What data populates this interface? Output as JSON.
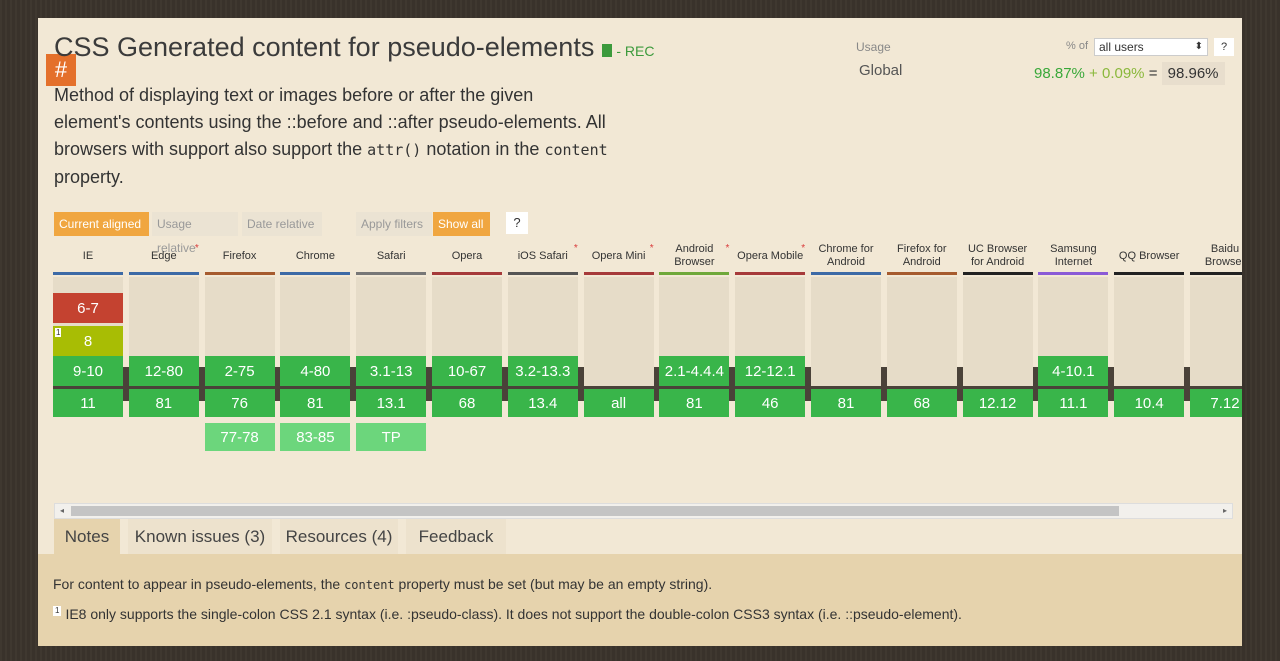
{
  "feature": {
    "hash": "#",
    "title": "CSS Generated content for pseudo-elements",
    "status": "- REC",
    "description_1": "Method of displaying text or images before or after the given element's contents using the ::before and ::after pseudo-elements. All browsers with support also support the ",
    "description_code1": "attr()",
    "description_2": " notation in the ",
    "description_code2": "content",
    "description_3": " property."
  },
  "usage": {
    "label": "Usage",
    "region": "Global",
    "pct_of": "% of",
    "select_value": "all users",
    "help": "?",
    "full": "98.87%",
    "plus": "+",
    "partial": "0.09%",
    "equals": "=",
    "total": "98.96%"
  },
  "filters": {
    "current_aligned": "Current aligned",
    "usage_relative": "Usage relative",
    "date_relative": "Date relative",
    "apply_filters": "Apply filters",
    "show_all": "Show all",
    "help": "?"
  },
  "colors": {
    "supported": "#39b54a",
    "future": "#6cd67c",
    "unsupported": "#c44230",
    "partial": "#a8bd04",
    "empty": "#e6dcc8",
    "accent": "#f0a640"
  },
  "browsers": [
    {
      "name": "IE",
      "star": false,
      "bar": "#3d6aa6",
      "past": [
        {
          "v": "6-7",
          "s": "n"
        },
        {
          "v": "8",
          "s": "a",
          "note": "1"
        },
        {
          "v": "9-10",
          "s": "y"
        }
      ],
      "current": "11",
      "future": []
    },
    {
      "name": "Edge",
      "star": true,
      "bar": "#3d6aa6",
      "past": [
        {
          "v": "",
          "s": "e"
        },
        {
          "v": "",
          "s": "e"
        },
        {
          "v": "12-80",
          "s": "y"
        }
      ],
      "current": "81",
      "future": []
    },
    {
      "name": "Firefox",
      "star": false,
      "bar": "#a65b2e",
      "past": [
        {
          "v": "",
          "s": "e"
        },
        {
          "v": "",
          "s": "e"
        },
        {
          "v": "2-75",
          "s": "y"
        }
      ],
      "current": "76",
      "future": [
        {
          "v": "77-78"
        }
      ]
    },
    {
      "name": "Chrome",
      "star": false,
      "bar": "#3d6aa6",
      "past": [
        {
          "v": "",
          "s": "e"
        },
        {
          "v": "",
          "s": "e"
        },
        {
          "v": "4-80",
          "s": "y"
        }
      ],
      "current": "81",
      "future": [
        {
          "v": "83-85"
        }
      ]
    },
    {
      "name": "Safari",
      "star": false,
      "bar": "#777777",
      "past": [
        {
          "v": "",
          "s": "e"
        },
        {
          "v": "",
          "s": "e"
        },
        {
          "v": "3.1-13",
          "s": "y"
        }
      ],
      "current": "13.1",
      "future": [
        {
          "v": "TP"
        }
      ]
    },
    {
      "name": "Opera",
      "star": false,
      "bar": "#a63a3a",
      "past": [
        {
          "v": "",
          "s": "e"
        },
        {
          "v": "",
          "s": "e"
        },
        {
          "v": "10-67",
          "s": "y"
        }
      ],
      "current": "68",
      "future": []
    },
    {
      "name": "iOS Safari",
      "star": true,
      "bar": "#555555",
      "past": [
        {
          "v": "",
          "s": "e"
        },
        {
          "v": "",
          "s": "e"
        },
        {
          "v": "3.2-13.3",
          "s": "y"
        }
      ],
      "current": "13.4",
      "future": []
    },
    {
      "name": "Opera Mini",
      "star": true,
      "bar": "#a63a3a",
      "past": [
        {
          "v": "",
          "s": "e"
        },
        {
          "v": "",
          "s": "e"
        },
        {
          "v": "",
          "s": "e"
        }
      ],
      "current": "all",
      "future": []
    },
    {
      "name": "Android Browser",
      "star": true,
      "bar": "#6fa83a",
      "past": [
        {
          "v": "",
          "s": "e"
        },
        {
          "v": "",
          "s": "e"
        },
        {
          "v": "2.1-4.4.4",
          "s": "y"
        }
      ],
      "current": "81",
      "future": []
    },
    {
      "name": "Opera Mobile",
      "star": true,
      "bar": "#a63a3a",
      "past": [
        {
          "v": "",
          "s": "e"
        },
        {
          "v": "",
          "s": "e"
        },
        {
          "v": "12-12.1",
          "s": "y"
        }
      ],
      "current": "46",
      "future": []
    },
    {
      "name": "Chrome for Android",
      "star": false,
      "bar": "#3d6aa6",
      "past": [
        {
          "v": "",
          "s": "e"
        },
        {
          "v": "",
          "s": "e"
        },
        {
          "v": "",
          "s": "e"
        }
      ],
      "current": "81",
      "future": []
    },
    {
      "name": "Firefox for Android",
      "star": false,
      "bar": "#a65b2e",
      "past": [
        {
          "v": "",
          "s": "e"
        },
        {
          "v": "",
          "s": "e"
        },
        {
          "v": "",
          "s": "e"
        }
      ],
      "current": "68",
      "future": []
    },
    {
      "name": "UC Browser for Android",
      "star": false,
      "bar": "#222222",
      "past": [
        {
          "v": "",
          "s": "e"
        },
        {
          "v": "",
          "s": "e"
        },
        {
          "v": "",
          "s": "e"
        }
      ],
      "current": "12.12",
      "future": []
    },
    {
      "name": "Samsung Internet",
      "star": false,
      "bar": "#8a5ad6",
      "past": [
        {
          "v": "",
          "s": "e"
        },
        {
          "v": "",
          "s": "e"
        },
        {
          "v": "4-10.1",
          "s": "y"
        }
      ],
      "current": "11.1",
      "future": []
    },
    {
      "name": "QQ Browser",
      "star": false,
      "bar": "#222222",
      "past": [
        {
          "v": "",
          "s": "e"
        },
        {
          "v": "",
          "s": "e"
        },
        {
          "v": "",
          "s": "e"
        }
      ],
      "current": "10.4",
      "future": []
    },
    {
      "name": "Baidu Browser",
      "star": false,
      "bar": "#222222",
      "past": [
        {
          "v": "",
          "s": "e"
        },
        {
          "v": "",
          "s": "e"
        },
        {
          "v": "",
          "s": "e"
        }
      ],
      "current": "7.12",
      "future": []
    }
  ],
  "tabs": [
    {
      "label": "Notes",
      "active": true
    },
    {
      "label": "Known issues (3)",
      "active": false
    },
    {
      "label": "Resources (4)",
      "active": false
    },
    {
      "label": "Feedback",
      "active": false
    }
  ],
  "notes": {
    "line1_a": "For content to appear in pseudo-elements, the ",
    "line1_code": "content",
    "line1_b": " property must be set (but may be an empty string).",
    "note_num": "1",
    "line2": "IE8 only supports the single-colon CSS 2.1 syntax (i.e. :pseudo-class). It does not support the double-colon CSS3 syntax (i.e. ::pseudo-element)."
  },
  "scroll": {
    "left_arrow": "◂",
    "right_arrow": "▸"
  }
}
